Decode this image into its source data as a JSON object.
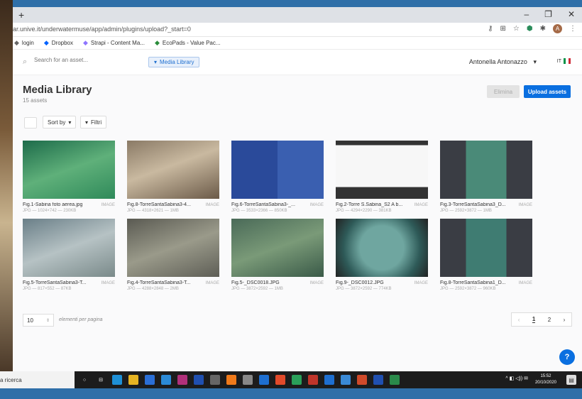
{
  "browser": {
    "url": "ar.unive.it/underwatermuse/app/admin/plugins/upload?_start=0",
    "bookmarks": [
      {
        "label": "login",
        "icon": "globe-icon",
        "color": "#666"
      },
      {
        "label": "Dropbox",
        "icon": "dropbox-icon",
        "color": "#0061fe"
      },
      {
        "label": "Strapi - Content Ma...",
        "icon": "strapi-icon",
        "color": "#8e75ff"
      },
      {
        "label": "EcoPads - Value Pac...",
        "icon": "ecopads-icon",
        "color": "#2a8c3a"
      }
    ],
    "avatar_letter": "A"
  },
  "header": {
    "search_placeholder": "Search for an asset...",
    "section": "Media Library",
    "user": "Antonella Antonazzo",
    "lang": "IT"
  },
  "main": {
    "title": "Media Library",
    "count": "15 assets",
    "delete_label": "Elimina",
    "upload_label": "Upload assets",
    "sort_label": "Sort by",
    "filter_label": "Filtri",
    "assets": [
      {
        "name": "Fig.1-Sabina foto aerea.jpg",
        "type": "IMAGE",
        "info": "JPG — 1024×742 — 230KB"
      },
      {
        "name": "Fig.8-TorreSantaSabina3-4...",
        "type": "IMAGE",
        "info": "JPG — 4318×2621 — 1MB"
      },
      {
        "name": "Fig.6-TorreSantaSabina3-_...",
        "type": "IMAGE",
        "info": "JPG — 3533×2366 — 850KB"
      },
      {
        "name": "Fig.2-Torre S.Sabina_S2 A b...",
        "type": "IMAGE",
        "info": "JPG — 4294×2290 — 381KB"
      },
      {
        "name": "Fig.3-TorreSantaSabina3_D...",
        "type": "IMAGE",
        "info": "JPG — 2592×3872 — 1MB"
      },
      {
        "name": "Fig.5-TorreSantaSabina3-T...",
        "type": "IMAGE",
        "info": "JPG — 817×552 — 87KB"
      },
      {
        "name": "Fig.4-TorreSantaSabina3-T...",
        "type": "IMAGE",
        "info": "JPG — 4288×2848 — 2MB"
      },
      {
        "name": "Fig.5-_DSC0018.JPG",
        "type": "IMAGE",
        "info": "JPG — 3872×2592 — 1MB"
      },
      {
        "name": "Fig.9-_DSC0012.JPG",
        "type": "IMAGE",
        "info": "JPG — 3872×2592 — 774KB"
      },
      {
        "name": "Fig.8-TorreSantaSabina1_D...",
        "type": "IMAGE",
        "info": "JPG — 2592×3872 — 960KB"
      }
    ],
    "per_page_value": "10",
    "per_page_label": "elementi per pagina",
    "pages": [
      "1",
      "2"
    ]
  },
  "taskbar": {
    "search": "a ricerca",
    "time": "15:52",
    "date": "20/10/2020"
  }
}
